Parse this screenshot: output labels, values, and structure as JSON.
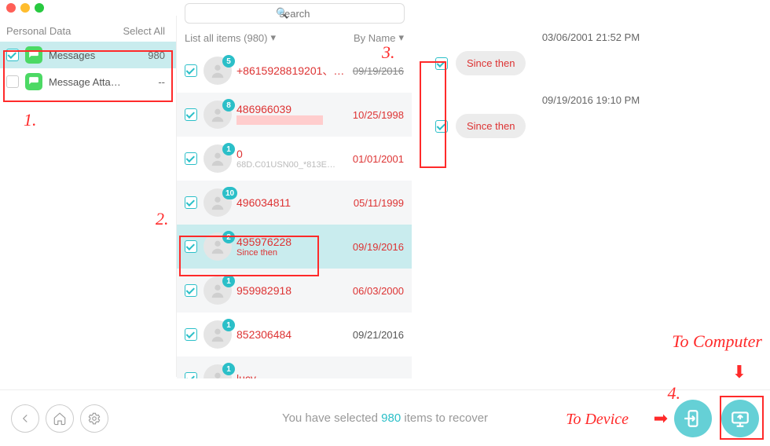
{
  "sidebar": {
    "header": "Personal Data",
    "select_all": "Select All",
    "items": [
      {
        "label": "Messages",
        "count": "980",
        "checked": true
      },
      {
        "label": "Message Atta…",
        "count": "--",
        "checked": false
      }
    ]
  },
  "search": {
    "placeholder": "search"
  },
  "list": {
    "header_left": "List all items (980)",
    "header_right": "By Name",
    "threads": [
      {
        "badge": "5",
        "title": "+8615928819201、…",
        "sub": "",
        "date": "09/19/2016",
        "date_strike": true
      },
      {
        "badge": "8",
        "title": "486966039",
        "sub_redbar": true,
        "date": "10/25/1998"
      },
      {
        "badge": "1",
        "title": "0",
        "sub": "68D.C01USN00_*813E…",
        "date": "01/01/2001"
      },
      {
        "badge": "10",
        "title": "496034811",
        "sub": "",
        "date": "05/11/1999"
      },
      {
        "badge": "2",
        "title": "495976228",
        "sub": "Since then",
        "sub_red": true,
        "date": "09/19/2016",
        "selected": true
      },
      {
        "badge": "1",
        "title": "959982918",
        "sub": "",
        "date": "06/03/2000"
      },
      {
        "badge": "1",
        "title": "852306484",
        "sub": "",
        "date": "09/21/2016",
        "date_black": true
      },
      {
        "badge": "1",
        "title": "lucy",
        "sub": "",
        "date": ""
      }
    ]
  },
  "conversation": {
    "times": [
      "03/06/2001 21:52 PM",
      "09/19/2016 19:10 PM"
    ],
    "messages": [
      {
        "text": "Since then"
      },
      {
        "text": "Since then"
      }
    ]
  },
  "footer": {
    "text_a": "You have selected ",
    "count": "980",
    "text_b": " items to recover"
  },
  "annotations": {
    "n1": "1.",
    "n2": "2.",
    "n3": "3.",
    "n4": "4.",
    "to_device": "To Device",
    "to_computer": "To Computer"
  }
}
